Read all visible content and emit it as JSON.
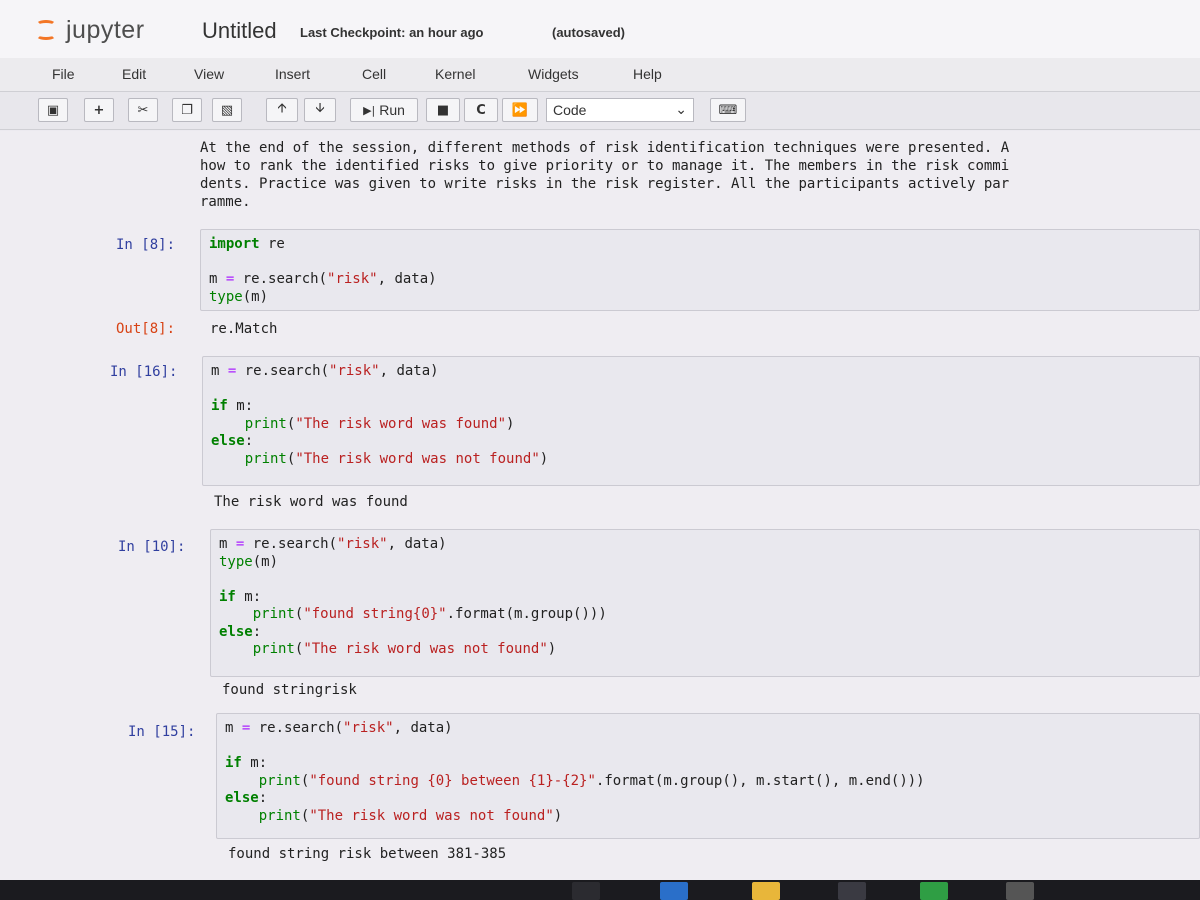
{
  "header": {
    "logo_text": "jupyter",
    "notebook_title": "Untitled",
    "checkpoint": "Last Checkpoint: an hour ago",
    "autosave": "(autosaved)"
  },
  "menu": [
    "File",
    "Edit",
    "View",
    "Insert",
    "Cell",
    "Kernel",
    "Widgets",
    "Help"
  ],
  "toolbar": {
    "run_label": "Run",
    "cell_type": "Code"
  },
  "markdown_cell": {
    "lines": [
      "At the end of the session, different methods of risk identification techniques were presented. A",
      "how to rank the identified risks to give priority or to manage it. The members in the risk commi",
      "dents. Practice was given to write risks in the risk register. All the participants actively par",
      "ramme."
    ]
  },
  "cells": [
    {
      "prompt": "In [8]:",
      "out_prompt": "Out[8]:",
      "output": "re.Match"
    },
    {
      "prompt": "In [16]:",
      "output": "The risk word was found"
    },
    {
      "prompt": "In [10]:",
      "output": "found stringrisk"
    },
    {
      "prompt": "In [15]:",
      "output": "found string risk between 381-385"
    }
  ],
  "code_strings": {
    "risk": "\"risk\"",
    "found": "\"The risk word was found\"",
    "not_found": "\"The risk word was not found\"",
    "found_fmt": "\"found string{0}\"",
    "between_fmt": "\"found string {0} between {1}-{2}\""
  },
  "colors": {
    "jupyter_orange": "#f37626",
    "prompt_in": "#303f9f",
    "prompt_out": "#d84315",
    "keyword": "#008000",
    "string": "#ba2121"
  }
}
